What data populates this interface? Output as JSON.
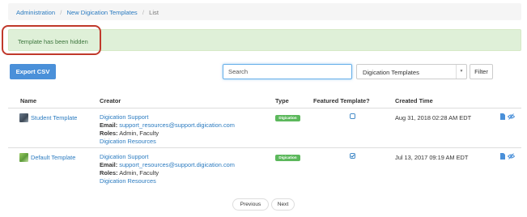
{
  "breadcrumb": {
    "items": [
      "Administration",
      "New Digication Templates",
      "List"
    ],
    "separator": "/"
  },
  "alert": {
    "message": "Template has been hidden"
  },
  "toolbar": {
    "export_label": "Export CSV",
    "search_placeholder": "Search",
    "select_value": "Digication Templates",
    "filter_label": "Filter"
  },
  "table": {
    "headers": {
      "name": "Name",
      "creator": "Creator",
      "type": "Type",
      "featured": "Featured Template?",
      "created": "Created Time"
    },
    "rows": [
      {
        "name": "Student Template",
        "thumbnail": "student-template-thumbnail",
        "creator_name": "Digication Support",
        "email_label": "Email:",
        "email": "support_resources@support.digication.com",
        "roles_label": "Roles:",
        "roles": "Admin, Faculty",
        "org": "Digication Resources",
        "type_badge": "Digication",
        "featured": false,
        "created": "Aug 31, 2018 02:28 AM EDT"
      },
      {
        "name": "Default Template",
        "thumbnail": "default-template-thumbnail",
        "creator_name": "Digication Support",
        "email_label": "Email:",
        "email": "support_resources@support.digication.com",
        "roles_label": "Roles:",
        "roles": "Admin, Faculty",
        "org": "Digication Resources",
        "type_badge": "Digication",
        "featured": true,
        "created": "Jul 13, 2017 09:19 AM EDT"
      }
    ]
  },
  "pagination": {
    "previous_label": "Previous",
    "next_label": "Next"
  },
  "colors": {
    "link": "#2b7bc0",
    "primary_button": "#4a90d9",
    "alert_background": "#dff0d8",
    "alert_text": "#3c763d",
    "highlight_outline": "#c0392b",
    "badge": "#5cb85c"
  },
  "icons": {
    "select_caret": "chevron-down-icon",
    "action_1": "document-icon",
    "action_2": "hidden-eye-icon",
    "featured_off": "checkbox-empty-icon",
    "featured_on": "checkbox-checked-icon"
  }
}
